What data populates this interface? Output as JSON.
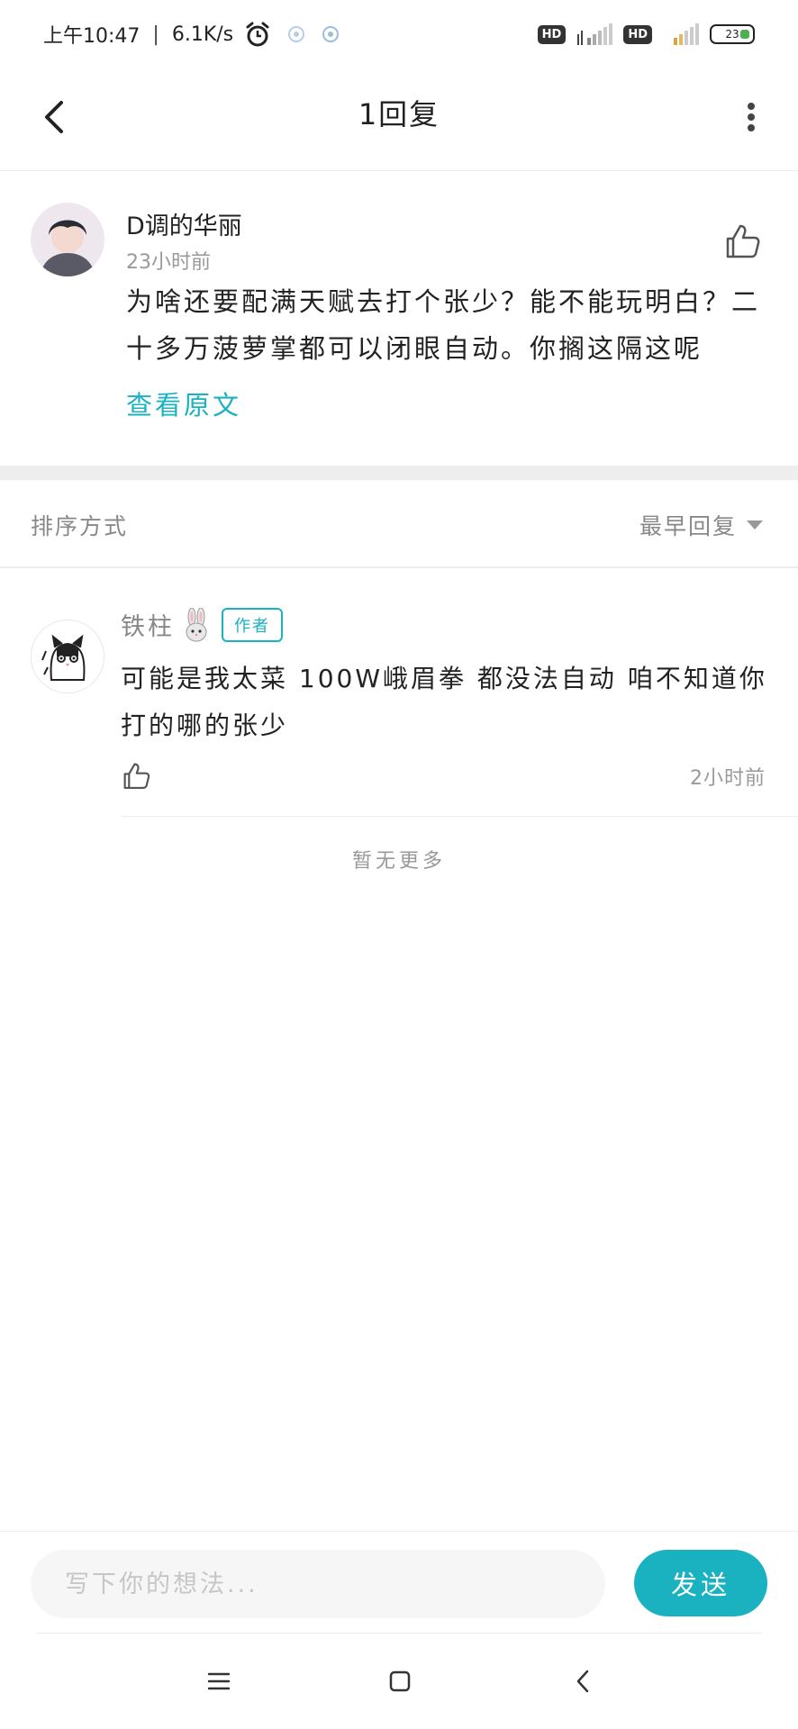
{
  "status_bar": {
    "time": "上午10:47",
    "speed": "6.1K/s",
    "hd_label": "HD",
    "battery": "23"
  },
  "header": {
    "title": "1回复"
  },
  "original_comment": {
    "username": "D调的华丽",
    "time": "23小时前",
    "text": "为啥还要配满天赋去打个张少？能不能玩明白？二十多万菠萝掌都可以闭眼自动。你搁这隔这呢",
    "view_original_label": "查看原文"
  },
  "sort_bar": {
    "label": "排序方式",
    "value": "最早回复"
  },
  "replies": [
    {
      "username": "铁柱",
      "badge": "作者",
      "text": "可能是我太菜 100W峨眉拳 都没法自动 咱不知道你打的哪的张少",
      "time": "2小时前"
    }
  ],
  "no_more_label": "暂无更多",
  "input": {
    "placeholder": "写下你的想法...",
    "send_label": "发送"
  },
  "colors": {
    "accent": "#1ab2c1",
    "muted": "#999999",
    "divider": "#eeeeee"
  }
}
